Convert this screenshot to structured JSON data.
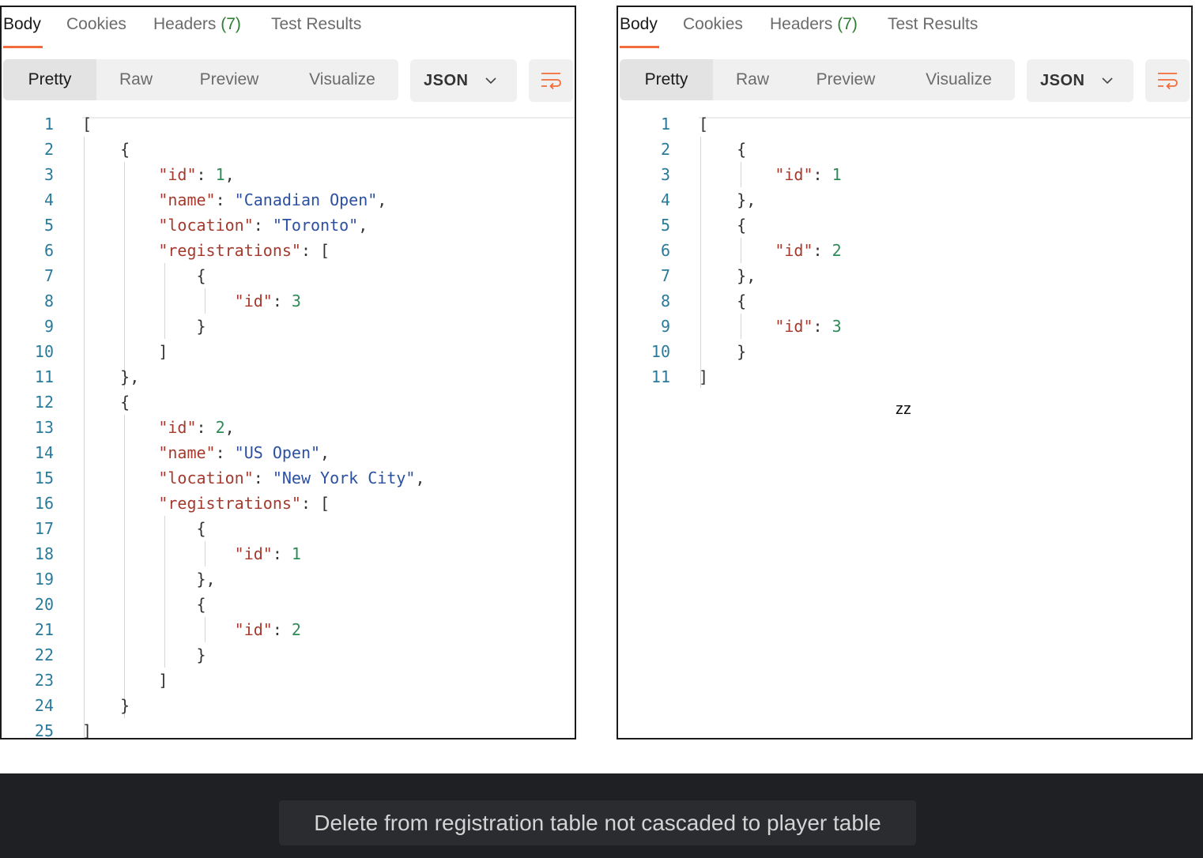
{
  "panels": [
    {
      "tabs": [
        "Body",
        "Cookies",
        "Headers",
        "Test Results"
      ],
      "headers_count": "(7)",
      "view_modes": [
        "Pretty",
        "Raw",
        "Preview",
        "Visualize"
      ],
      "format": "JSON",
      "lines": [
        [
          [
            "p",
            "["
          ]
        ],
        [
          [
            "p",
            "    {"
          ]
        ],
        [
          [
            "p",
            "        "
          ],
          [
            "k",
            "\"id\""
          ],
          [
            "p",
            ": "
          ],
          [
            "n",
            "1"
          ],
          [
            "p",
            ","
          ]
        ],
        [
          [
            "p",
            "        "
          ],
          [
            "k",
            "\"name\""
          ],
          [
            "p",
            ": "
          ],
          [
            "s",
            "\"Canadian Open\""
          ],
          [
            "p",
            ","
          ]
        ],
        [
          [
            "p",
            "        "
          ],
          [
            "k",
            "\"location\""
          ],
          [
            "p",
            ": "
          ],
          [
            "s",
            "\"Toronto\""
          ],
          [
            "p",
            ","
          ]
        ],
        [
          [
            "p",
            "        "
          ],
          [
            "k",
            "\"registrations\""
          ],
          [
            "p",
            ": ["
          ]
        ],
        [
          [
            "p",
            "            {"
          ]
        ],
        [
          [
            "p",
            "                "
          ],
          [
            "k",
            "\"id\""
          ],
          [
            "p",
            ": "
          ],
          [
            "n",
            "3"
          ]
        ],
        [
          [
            "p",
            "            }"
          ]
        ],
        [
          [
            "p",
            "        ]"
          ]
        ],
        [
          [
            "p",
            "    },"
          ]
        ],
        [
          [
            "p",
            "    {"
          ]
        ],
        [
          [
            "p",
            "        "
          ],
          [
            "k",
            "\"id\""
          ],
          [
            "p",
            ": "
          ],
          [
            "n",
            "2"
          ],
          [
            "p",
            ","
          ]
        ],
        [
          [
            "p",
            "        "
          ],
          [
            "k",
            "\"name\""
          ],
          [
            "p",
            ": "
          ],
          [
            "s",
            "\"US Open\""
          ],
          [
            "p",
            ","
          ]
        ],
        [
          [
            "p",
            "        "
          ],
          [
            "k",
            "\"location\""
          ],
          [
            "p",
            ": "
          ],
          [
            "s",
            "\"New York City\""
          ],
          [
            "p",
            ","
          ]
        ],
        [
          [
            "p",
            "        "
          ],
          [
            "k",
            "\"registrations\""
          ],
          [
            "p",
            ": ["
          ]
        ],
        [
          [
            "p",
            "            {"
          ]
        ],
        [
          [
            "p",
            "                "
          ],
          [
            "k",
            "\"id\""
          ],
          [
            "p",
            ": "
          ],
          [
            "n",
            "1"
          ]
        ],
        [
          [
            "p",
            "            },"
          ]
        ],
        [
          [
            "p",
            "            {"
          ]
        ],
        [
          [
            "p",
            "                "
          ],
          [
            "k",
            "\"id\""
          ],
          [
            "p",
            ": "
          ],
          [
            "n",
            "2"
          ]
        ],
        [
          [
            "p",
            "            }"
          ]
        ],
        [
          [
            "p",
            "        ]"
          ]
        ],
        [
          [
            "p",
            "    }"
          ]
        ],
        [
          [
            "p",
            "]"
          ]
        ]
      ]
    },
    {
      "tabs": [
        "Body",
        "Cookies",
        "Headers",
        "Test Results"
      ],
      "headers_count": "(7)",
      "view_modes": [
        "Pretty",
        "Raw",
        "Preview",
        "Visualize"
      ],
      "format": "JSON",
      "lines": [
        [
          [
            "p",
            "["
          ]
        ],
        [
          [
            "p",
            "    {"
          ]
        ],
        [
          [
            "p",
            "        "
          ],
          [
            "k",
            "\"id\""
          ],
          [
            "p",
            ": "
          ],
          [
            "n",
            "1"
          ]
        ],
        [
          [
            "p",
            "    },"
          ]
        ],
        [
          [
            "p",
            "    {"
          ]
        ],
        [
          [
            "p",
            "        "
          ],
          [
            "k",
            "\"id\""
          ],
          [
            "p",
            ": "
          ],
          [
            "n",
            "2"
          ]
        ],
        [
          [
            "p",
            "    },"
          ]
        ],
        [
          [
            "p",
            "    {"
          ]
        ],
        [
          [
            "p",
            "        "
          ],
          [
            "k",
            "\"id\""
          ],
          [
            "p",
            ": "
          ],
          [
            "n",
            "3"
          ]
        ],
        [
          [
            "p",
            "    }"
          ]
        ],
        [
          [
            "p",
            "]"
          ]
        ]
      ]
    }
  ],
  "overlay_text": "zz",
  "caption": "Delete from registration table not cascaded to player table",
  "colors": {
    "accent": "#f26b3a",
    "key": "#a33a2e",
    "string": "#2b50a0",
    "number": "#2e8a57",
    "line_number": "#2a7a9a",
    "caption_bg": "#1f2024"
  }
}
